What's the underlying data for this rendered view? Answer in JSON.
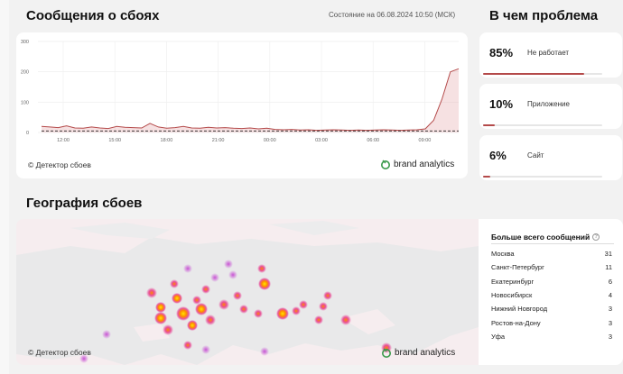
{
  "chart_section": {
    "title": "Сообщения о сбоях",
    "status": "Состояние на 06.08.2024 10:50 (МСК)",
    "copyright": "© Детектор сбоев",
    "brand": "brand analytics"
  },
  "chart_data": {
    "type": "area",
    "x": [
      "12:00",
      "15:00",
      "18:00",
      "21:00",
      "00:00",
      "03:00",
      "06:00",
      "09:00"
    ],
    "yticks": [
      0,
      100,
      200,
      300
    ],
    "ylim": [
      0,
      300
    ],
    "series": [
      {
        "values": [
          20,
          18,
          16,
          22,
          15,
          14,
          18,
          15,
          13,
          20,
          17,
          16,
          15,
          30,
          18,
          14,
          16,
          20,
          15,
          14,
          17,
          15,
          16,
          14,
          13,
          15,
          12,
          14,
          10,
          9,
          10,
          8,
          9,
          7,
          8,
          9,
          8,
          7,
          8,
          7,
          8,
          9,
          8,
          7,
          8,
          9,
          12,
          40,
          110,
          200,
          210
        ]
      }
    ],
    "baseline": 5,
    "colors": {
      "line": "#b44a4a",
      "fill": "#e6a8ad",
      "baseline": "#222222"
    }
  },
  "problems": {
    "title": "В чем проблема",
    "items": [
      {
        "percent": "85%",
        "label": "Не работает",
        "value": 85
      },
      {
        "percent": "10%",
        "label": "Приложение",
        "value": 10
      },
      {
        "percent": "6%",
        "label": "Сайт",
        "value": 6
      }
    ]
  },
  "geo_section": {
    "title": "География сбоев",
    "copyright": "© Детектор сбоев",
    "brand": "brand analytics"
  },
  "top_cities": {
    "title": "Больше всего сообщений",
    "rows": [
      {
        "city": "Москва",
        "count": "31"
      },
      {
        "city": "Санкт-Петербург",
        "count": "11"
      },
      {
        "city": "Екатеринбург",
        "count": "6"
      },
      {
        "city": "Новосибирск",
        "count": "4"
      },
      {
        "city": "Нижний Новгород",
        "count": "3"
      },
      {
        "city": "Ростов-на-Дону",
        "count": "3"
      },
      {
        "city": "Уфа",
        "count": "3"
      }
    ]
  }
}
